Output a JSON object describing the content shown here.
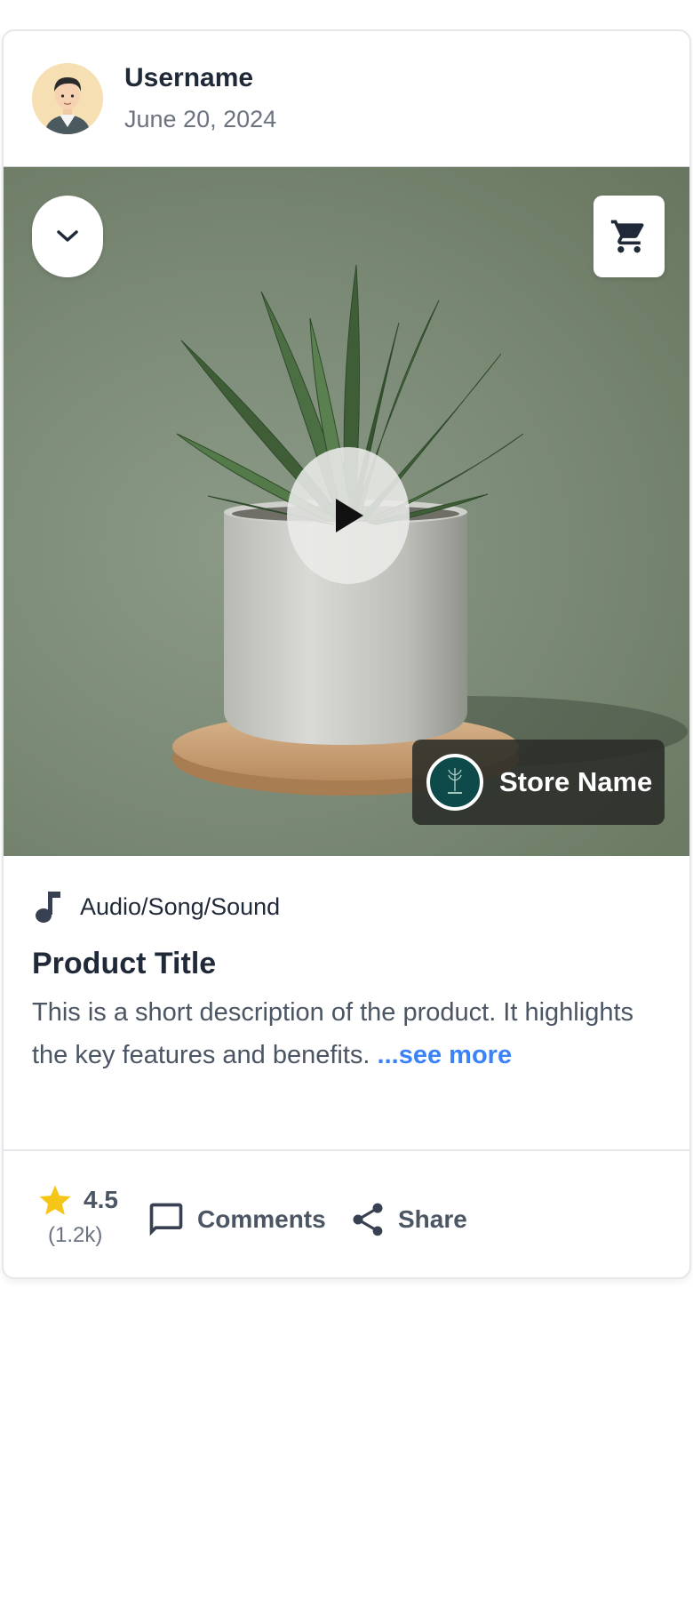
{
  "post": {
    "username": "Username",
    "date": "June 20, 2024"
  },
  "media": {
    "store_name": "Store Name",
    "icons": {
      "collapse": "chevron-down-icon",
      "cart": "cart-icon",
      "play": "play-icon"
    }
  },
  "product": {
    "audio_label": "Audio/Song/Sound",
    "title": "Product Title",
    "description": "This is a short description of the product. It highlights the key features and benefits.",
    "see_more": "...see more"
  },
  "footer": {
    "rating": "4.5",
    "rating_count": "(1.2k)",
    "comments_label": "Comments",
    "share_label": "Share"
  },
  "colors": {
    "accent": "#3b82f6",
    "star": "#f5c518",
    "store_logo": "#0f4a4a"
  }
}
